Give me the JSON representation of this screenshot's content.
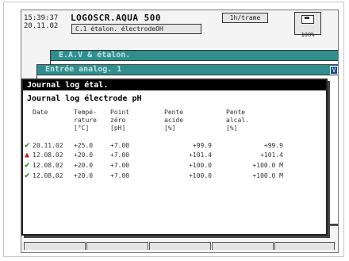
{
  "header": {
    "time": "15:39:37",
    "date": "20.11.02",
    "title": "LOGOSCR.AQUA 500",
    "rate": "1h/trame",
    "subtitle": "C.1 étalon. électrodeOH",
    "memory_pct": "100%",
    "disk_icon": "floppy-disk-icon"
  },
  "windows": {
    "back": {
      "title": "E.A.V & étalon."
    },
    "middle": {
      "title": "Entrée analog. 1",
      "marker": "V"
    },
    "front": {
      "title": "Journal log étal.",
      "heading": "Journal log électrode pH",
      "columns": [
        "Date",
        "Tempé-\nrature\n[°C]",
        "Point\nzéro\n[pH]",
        "Pente\nacide\n[%]",
        "Pente\nalcal.\n[%]"
      ],
      "rows": [
        {
          "status": "ok",
          "status_icon": "check-icon",
          "date": "20.11.02",
          "temp": "+25.0",
          "zero": "+7.00",
          "acid": "+99.9",
          "alcal": "+99.9"
        },
        {
          "status": "warn",
          "status_icon": "warning-triangle-icon",
          "date": "12.08.02",
          "temp": "+20.0",
          "zero": "+7.00",
          "acid": "+101.4",
          "alcal": "+101.4"
        },
        {
          "status": "ok",
          "status_icon": "check-icon",
          "date": "12.08.02",
          "temp": "+20.0",
          "zero": "+7.00",
          "acid": "+100.0",
          "alcal": "+100.0 M"
        },
        {
          "status": "ok",
          "status_icon": "check-icon",
          "date": "12.08.02",
          "temp": "+20.0",
          "zero": "+7.00",
          "acid": "+100.0",
          "alcal": "+100.0 M"
        }
      ]
    }
  },
  "colors": {
    "accent": "#2f8f8f",
    "ok": "#1a8a1a",
    "warn": "#c81818"
  },
  "softkeys": [
    "",
    "",
    "",
    "",
    ""
  ]
}
